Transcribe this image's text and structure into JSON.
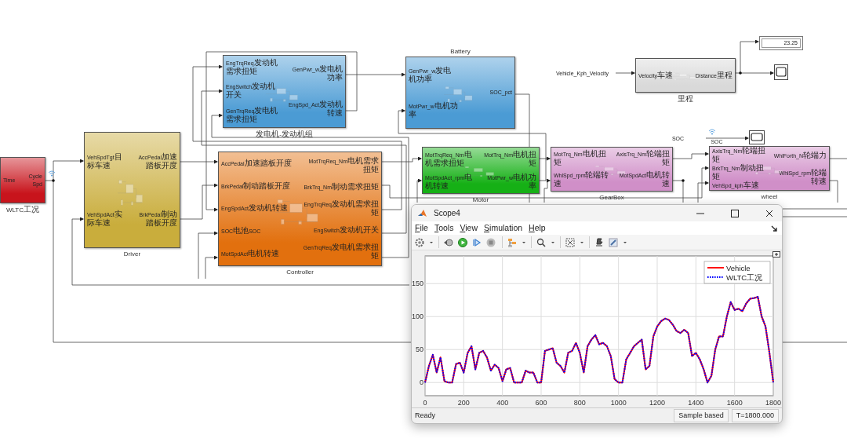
{
  "diagram": {
    "blocks": [
      {
        "kind": "source",
        "color": "#c8141c",
        "inputs": [
          "Time"
        ],
        "outputs": [
          "CycleSpd"
        ],
        "caption": "WLTC工况"
      },
      {
        "kind": "subsystem",
        "color": "#c9ad3c",
        "inputs": [
          "VehSpdTgt目标车速",
          "VehSpdAct实际车速"
        ],
        "outputs": [
          "AccPedal加速踏板开度",
          "BrkPedal制动踏板开度"
        ],
        "caption": "Driver"
      },
      {
        "kind": "subsystem",
        "color": "#4b9bd4",
        "inputs": [
          "EngTrqReq发动机需求扭矩",
          "EngSwitch发动机开关",
          "GenTrqReq发电机需求扭矩"
        ],
        "outputs": [
          "GenPwr_w发电机功率",
          "EngSpd_Act发动机转速"
        ],
        "caption": "发电机-发动机组"
      },
      {
        "kind": "subsystem",
        "color": "#e2700e",
        "inputs": [
          "AccPedal加速踏板开度",
          "BrkPedal制动踏板开度",
          "EngSpdAct发动机转速",
          "SOC电池SOC",
          "MotSpdAct电机转速"
        ],
        "outputs": [
          "MotTrqReq_Nm电机需求扭矩",
          "BrkTrq_Nm制动需求扭矩",
          "EngTrqReq发动机需求扭矩",
          "EngSwitch发动机开关",
          "GenTrqReq发电机需求扭矩"
        ],
        "caption": "Controller"
      },
      {
        "kind": "subsystem",
        "color": "#4b9bd4",
        "title": "Battery",
        "inputs": [
          "GenPwr_w发电机功率",
          "MotPwr_w电机功率"
        ],
        "outputs": [
          "SOC_pct"
        ]
      },
      {
        "kind": "subsystem",
        "color": "#16b016",
        "inputs": [
          "MotTrqReq_Nm电机需求扭矩",
          "MotSpdAct_rpm电机转速"
        ],
        "outputs": [
          "MotTrq_Nm电机扭矩",
          "MotPwr_w电机功率"
        ],
        "caption": "Motor"
      },
      {
        "kind": "subsystem",
        "color": "#d08fc8",
        "inputs": [
          "MotTrq_Nm电机扭矩",
          "WhlSpd_rpm轮端转速"
        ],
        "outputs": [
          "AxisTrq_Nm轮端扭矩",
          "MotSpdAct电机转速"
        ],
        "caption": "GearBox"
      },
      {
        "kind": "subsystem",
        "color": "#d9d9d9",
        "inputs": [
          "Velocity车速"
        ],
        "outputs": [
          "Distance里程"
        ],
        "caption": "里程"
      },
      {
        "kind": "subsystem",
        "color": "#d08fc8",
        "inputs": [
          "AxisTrq_Nm轮端扭矩",
          "BrkTrq_Nm制动扭矩",
          "VehSpd_kph车速"
        ],
        "outputs": [
          "WhlForth_N轮端力",
          "WhlSpd_rpm轮端转速"
        ],
        "caption": "wheel"
      }
    ],
    "tags": [
      {
        "text": "Vehicle_Kph_Velocity"
      },
      {
        "text": "SOC"
      }
    ],
    "signal_labels": [
      "SOC"
    ],
    "display": {
      "value": "23.25"
    }
  },
  "scope": {
    "title": "Scope4",
    "menu": [
      "File",
      "Tools",
      "View",
      "Simulation",
      "Help"
    ],
    "chart_data": {
      "type": "line",
      "x": [
        0,
        20,
        40,
        60,
        80,
        100,
        120,
        140,
        160,
        180,
        200,
        220,
        240,
        260,
        280,
        300,
        320,
        340,
        360,
        380,
        400,
        420,
        440,
        460,
        480,
        500,
        520,
        540,
        560,
        580,
        600,
        620,
        640,
        660,
        680,
        700,
        720,
        740,
        760,
        780,
        800,
        820,
        840,
        860,
        880,
        900,
        920,
        940,
        960,
        980,
        1000,
        1020,
        1040,
        1060,
        1080,
        1100,
        1120,
        1140,
        1160,
        1180,
        1200,
        1220,
        1240,
        1260,
        1280,
        1300,
        1320,
        1340,
        1360,
        1380,
        1400,
        1420,
        1440,
        1460,
        1480,
        1500,
        1520,
        1540,
        1560,
        1580,
        1600,
        1620,
        1640,
        1660,
        1680,
        1700,
        1720,
        1740,
        1760,
        1780,
        1800
      ],
      "series": [
        {
          "name": "Vehicle",
          "color": "#ff0000",
          "line_style": "solid",
          "values": [
            0,
            25,
            42,
            15,
            38,
            2,
            0,
            0,
            28,
            30,
            15,
            45,
            55,
            20,
            45,
            48,
            38,
            18,
            27,
            22,
            2,
            20,
            22,
            0,
            0,
            0,
            18,
            15,
            15,
            0,
            0,
            48,
            50,
            52,
            30,
            25,
            15,
            45,
            48,
            60,
            45,
            15,
            55,
            65,
            72,
            58,
            60,
            55,
            40,
            5,
            0,
            0,
            35,
            45,
            55,
            60,
            65,
            20,
            25,
            70,
            85,
            93,
            97,
            95,
            88,
            78,
            75,
            80,
            75,
            40,
            45,
            35,
            20,
            0,
            10,
            50,
            70,
            70,
            100,
            122,
            110,
            112,
            108,
            120,
            127,
            128,
            130,
            100,
            85,
            45,
            0
          ]
        },
        {
          "name": "WLTC工况",
          "color": "#0000ff",
          "line_style": "dotted",
          "values": [
            0,
            25,
            42,
            15,
            38,
            2,
            0,
            0,
            28,
            30,
            15,
            45,
            55,
            20,
            45,
            48,
            38,
            18,
            27,
            22,
            2,
            20,
            22,
            0,
            0,
            0,
            18,
            15,
            15,
            0,
            0,
            48,
            50,
            52,
            30,
            25,
            15,
            45,
            48,
            60,
            45,
            15,
            55,
            65,
            72,
            58,
            60,
            55,
            40,
            5,
            0,
            0,
            35,
            45,
            55,
            60,
            65,
            20,
            25,
            70,
            85,
            93,
            97,
            95,
            88,
            78,
            75,
            80,
            75,
            40,
            45,
            35,
            20,
            0,
            10,
            50,
            70,
            70,
            100,
            122,
            110,
            112,
            108,
            120,
            127,
            128,
            130,
            100,
            85,
            45,
            0
          ]
        }
      ],
      "grid": true,
      "legend": true,
      "xlim": [
        0,
        1800
      ],
      "ylim": [
        -20,
        192
      ],
      "xticks": [
        0,
        200,
        400,
        600,
        800,
        1000,
        1200,
        1400,
        1600,
        1800
      ],
      "yticks": [
        0,
        50,
        100,
        150
      ]
    },
    "status": "Ready",
    "mode": "Sample based",
    "time": "T=1800.000"
  }
}
